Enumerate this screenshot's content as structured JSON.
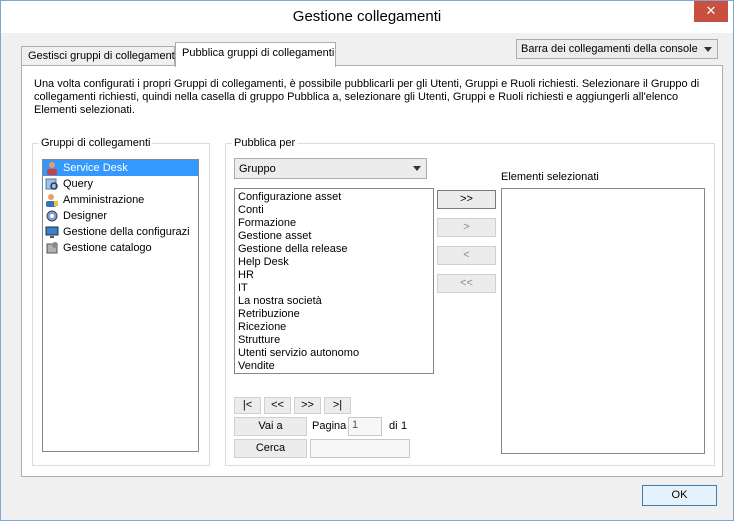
{
  "window": {
    "title": "Gestione collegamenti",
    "close_label": "✕"
  },
  "tabs": [
    {
      "label": "Gestisci gruppi di collegamenti",
      "active": false
    },
    {
      "label": "Pubblica gruppi di collegamenti",
      "active": true
    }
  ],
  "console_select": {
    "value": "Barra dei collegamenti della console"
  },
  "description": "Una volta configurati i propri Gruppi di collegamenti, è possibile pubblicarli per gli Utenti, Gruppi e Ruoli richiesti. Selezionare il Gruppo di collegamenti richiesti, quindi nella casella di gruppo Pubblica a, selezionare gli Utenti, Gruppi e Ruoli richiesti e aggiungerli all'elenco Elementi selezionati.",
  "groups_panel": {
    "label": "Gruppi di collegamenti",
    "items": [
      {
        "label": "Service Desk",
        "icon": "service-desk-icon",
        "selected": true
      },
      {
        "label": "Query",
        "icon": "query-icon",
        "selected": false
      },
      {
        "label": "Amministrazione",
        "icon": "administration-icon",
        "selected": false
      },
      {
        "label": "Designer",
        "icon": "designer-icon",
        "selected": false
      },
      {
        "label": "Gestione della configurazi",
        "icon": "configuration-icon",
        "selected": false
      },
      {
        "label": "Gestione catalogo",
        "icon": "catalog-icon",
        "selected": false
      }
    ]
  },
  "publish_panel": {
    "label": "Pubblica per",
    "type_select": "Gruppo",
    "items": [
      "Configurazione asset",
      "Conti",
      "Formazione",
      "Gestione asset",
      "Gestione della release",
      "Help Desk",
      "HR",
      "IT",
      "La nostra società",
      "Retribuzione",
      "Ricezione",
      "Strutture",
      "Utenti servizio autonomo",
      "Vendite"
    ],
    "transfer_buttons": {
      "add_all": ">>",
      "add": ">",
      "remove": "<",
      "remove_all": "<<"
    },
    "pager": {
      "first": "|<",
      "prev": "<<",
      "next": ">>",
      "last": ">|",
      "goto_label": "Vai a",
      "page_label": "Pagina",
      "page_value": "1",
      "of_label": "di",
      "total_pages": "1",
      "search_label": "Cerca",
      "search_value": ""
    },
    "selected_label": "Elementi selezionati"
  },
  "footer": {
    "ok_label": "OK"
  }
}
